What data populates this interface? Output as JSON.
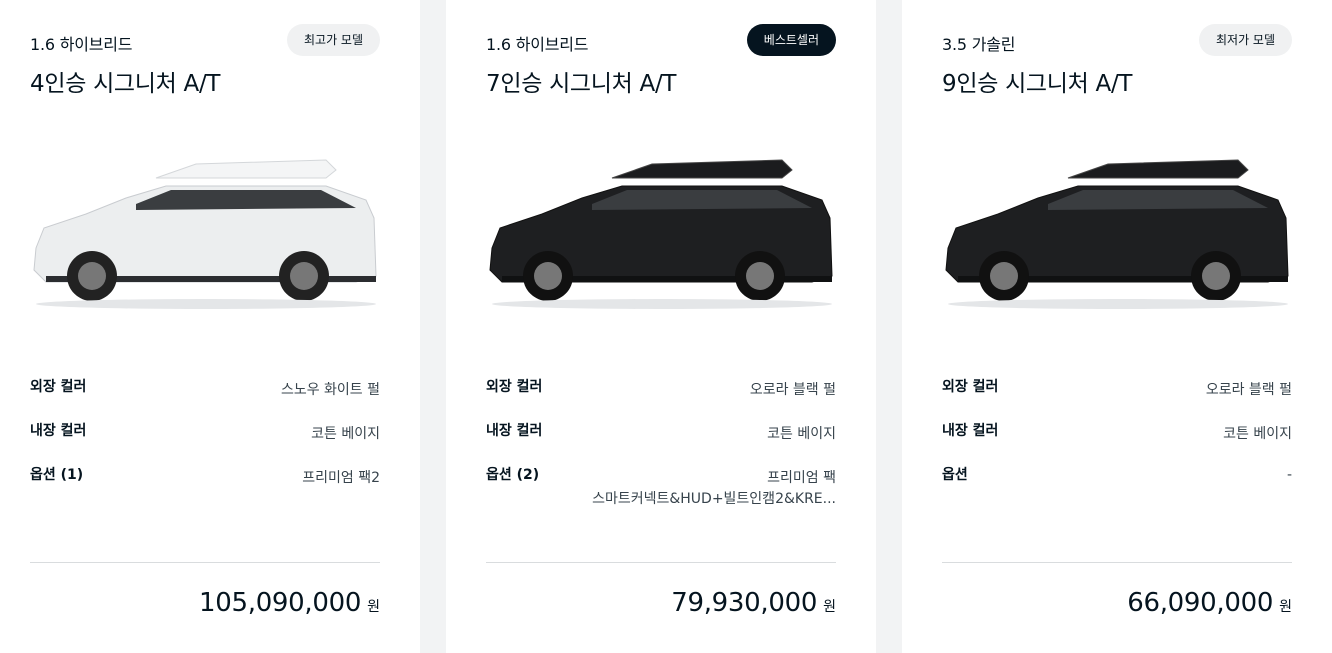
{
  "cards": [
    {
      "engine": "1.6 하이브리드",
      "badge": "최고가 모델",
      "trim": "4인승 시그니처 A/T",
      "car_color": "#eceeef",
      "specs": {
        "exterior_label": "외장 컬러",
        "exterior_value": "스노우 화이트 펄",
        "interior_label": "내장 컬러",
        "interior_value": "코튼 베이지",
        "option_label": "옵션 (1)",
        "option_value": "프리미엄 팩2",
        "option_value_2": ""
      },
      "price": "105,090,000",
      "price_unit": "원"
    },
    {
      "engine": "1.6 하이브리드",
      "badge": "베스트셀러",
      "trim": "7인승 시그니처 A/T",
      "car_color": "#1e1f21",
      "specs": {
        "exterior_label": "외장 컬러",
        "exterior_value": "오로라 블랙 펄",
        "interior_label": "내장 컬러",
        "interior_value": "코튼 베이지",
        "option_label": "옵션 (2)",
        "option_value": "프리미엄 팩",
        "option_value_2": "스마트커넥트&HUD+빌트인캠2&KRE..."
      },
      "price": "79,930,000",
      "price_unit": "원"
    },
    {
      "engine": "3.5 가솔린",
      "badge": "최저가 모델",
      "trim": "9인승 시그니처 A/T",
      "car_color": "#1e1f21",
      "specs": {
        "exterior_label": "외장 컬러",
        "exterior_value": "오로라 블랙 펄",
        "interior_label": "내장 컬러",
        "interior_value": "코튼 베이지",
        "option_label": "옵션",
        "option_value": "-",
        "option_value_2": ""
      },
      "price": "66,090,000",
      "price_unit": "원"
    }
  ]
}
